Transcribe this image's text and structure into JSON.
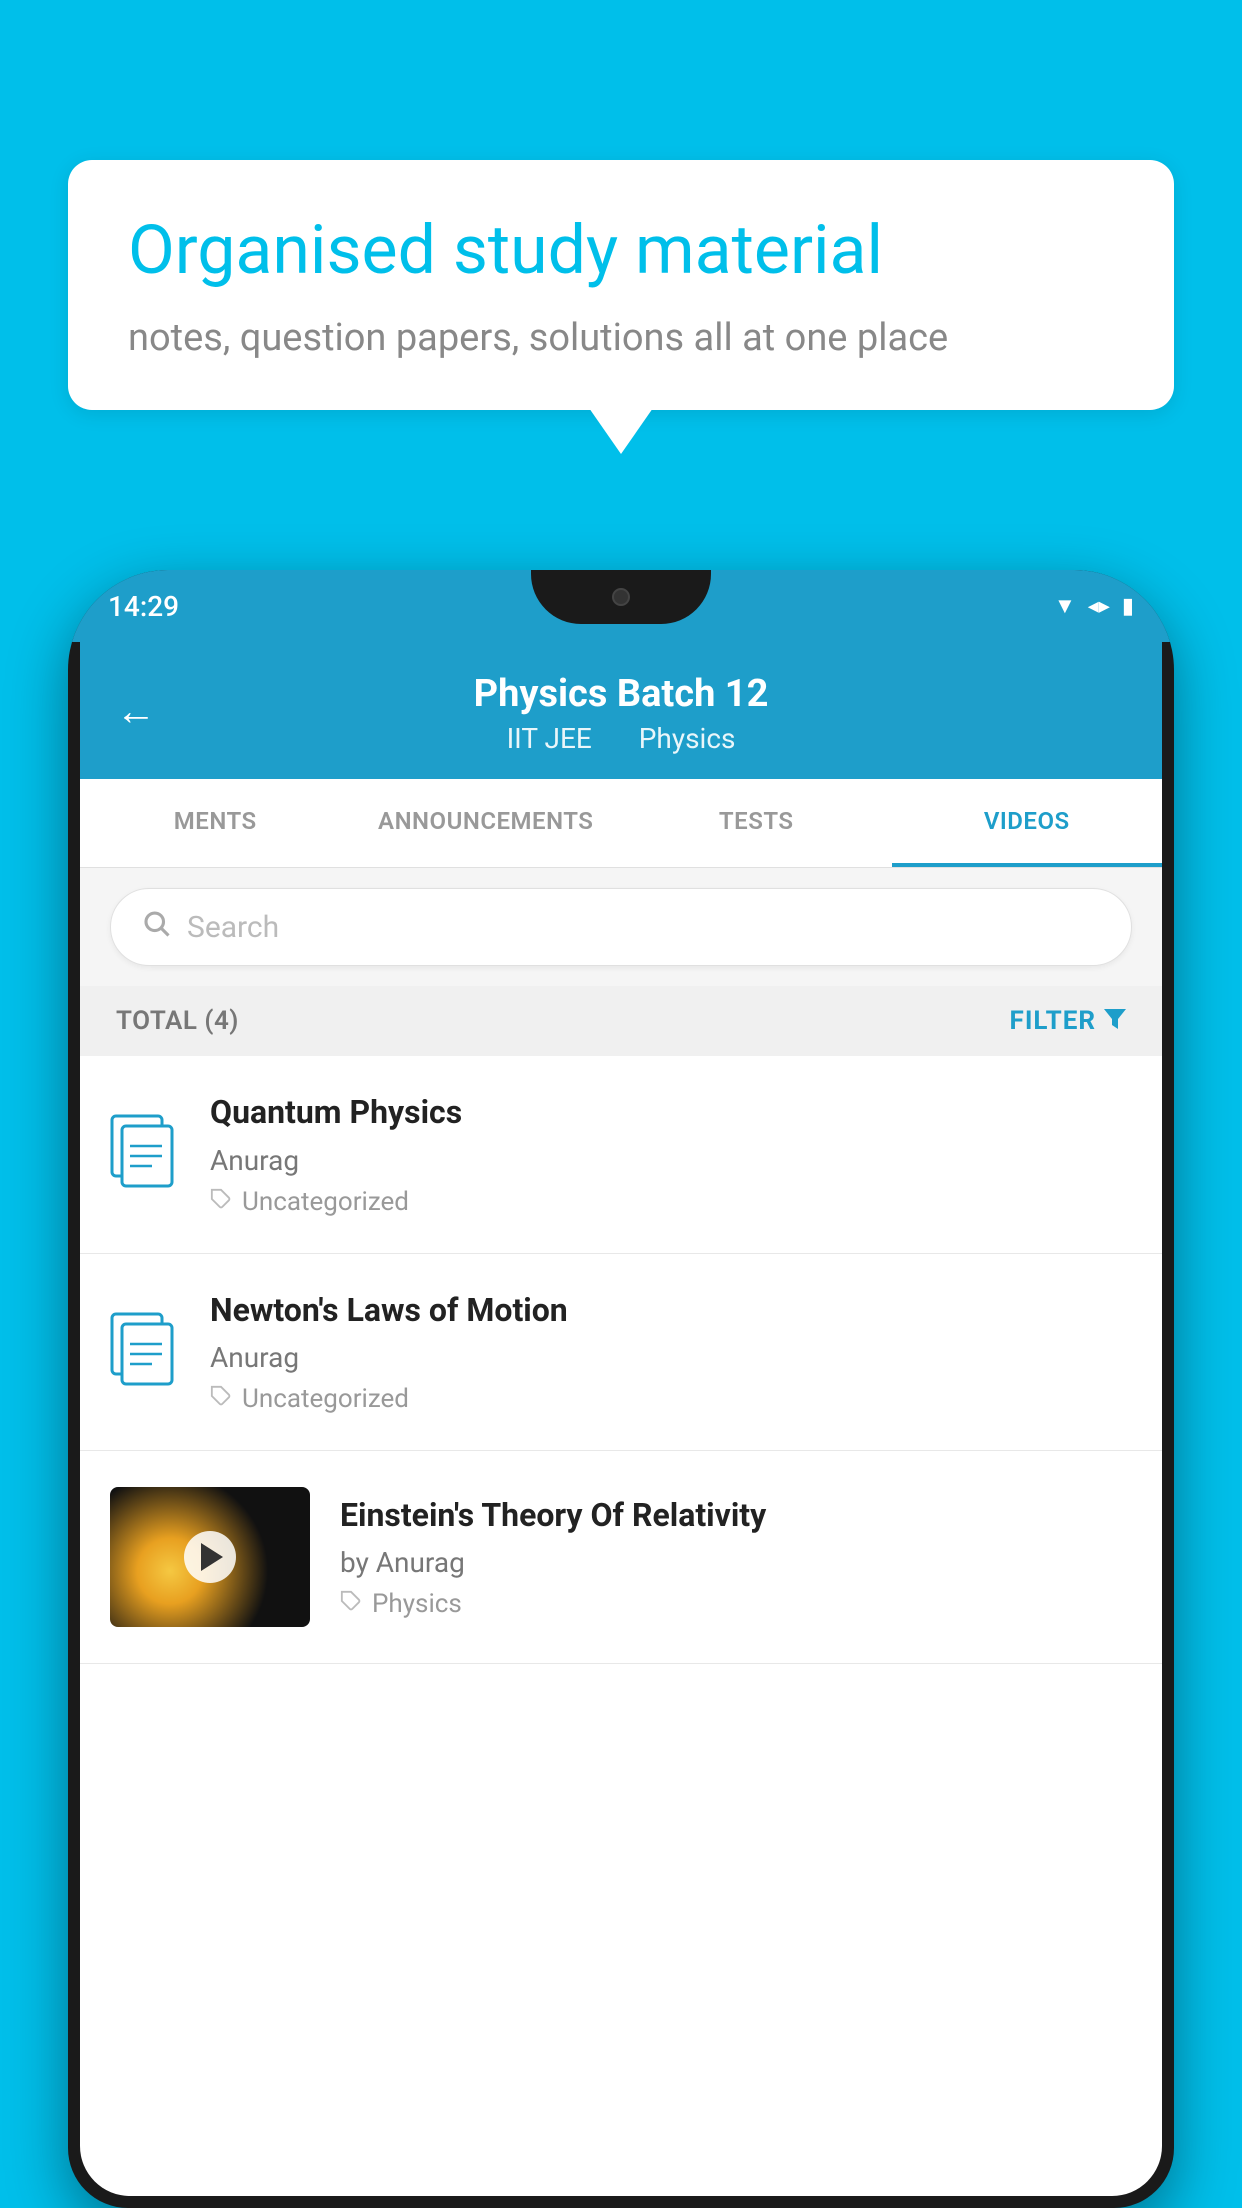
{
  "bubble": {
    "title": "Organised study material",
    "subtitle": "notes, question papers, solutions all at one place"
  },
  "status_bar": {
    "time": "14:29"
  },
  "header": {
    "title": "Physics Batch 12",
    "subtitle1": "IIT JEE",
    "subtitle2": "Physics",
    "back_label": "←"
  },
  "tabs": [
    {
      "label": "MENTS",
      "active": false
    },
    {
      "label": "ANNOUNCEMENTS",
      "active": false
    },
    {
      "label": "TESTS",
      "active": false
    },
    {
      "label": "VIDEOS",
      "active": true
    }
  ],
  "search": {
    "placeholder": "Search"
  },
  "filter_bar": {
    "total_label": "TOTAL (4)",
    "filter_label": "FILTER"
  },
  "videos": [
    {
      "title": "Quantum Physics",
      "author": "Anurag",
      "tag": "Uncategorized",
      "has_thumb": false
    },
    {
      "title": "Newton's Laws of Motion",
      "author": "Anurag",
      "tag": "Uncategorized",
      "has_thumb": false
    },
    {
      "title": "Einstein's Theory Of Relativity",
      "author": "by Anurag",
      "tag": "Physics",
      "has_thumb": true
    }
  ]
}
